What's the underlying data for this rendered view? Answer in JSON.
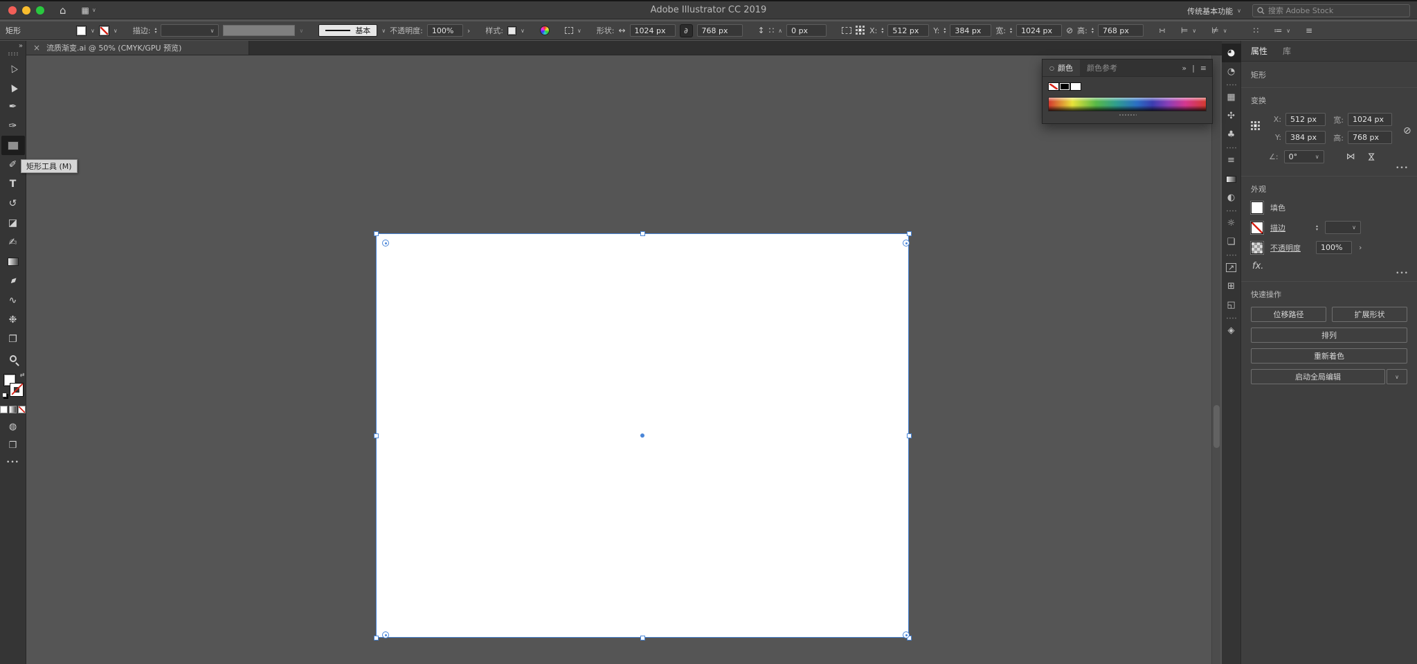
{
  "colors": {
    "accent_blue": "#4a86d8",
    "canvas_gray": "#555555",
    "none_red": "#d82418"
  },
  "icons": {
    "home": "⌂",
    "layout_grid": "▦",
    "chevron_down": "∨",
    "chevron_right": "›",
    "chevron_up": "∧",
    "stepper_up": "▴",
    "stepper_down": "▾",
    "collapse": "»",
    "menu": "≡",
    "close": "×",
    "more": "•••",
    "link": "∂",
    "unlink": "⊘",
    "width_arrow": "↔",
    "height_arrow": "↕",
    "dots": "∷",
    "flip": "⋈",
    "angle": "∠:",
    "swap": "⇄",
    "tab_dot": "○",
    "transform_more": "∺",
    "align_objects": "⊨",
    "distribute_objects": "⊭",
    "align_to": "≔",
    "export_arrow": "↗"
  },
  "window": {
    "title": "Adobe Illustrator CC 2019",
    "workspace_switcher": "传统基本功能",
    "search_placeholder": "搜索 Adobe Stock"
  },
  "control_bar": {
    "tool_name": "矩形",
    "stroke_label": "描边:",
    "stroke_style": "基本",
    "opacity_label": "不透明度:",
    "opacity_value": "100%",
    "style_label": "样式:",
    "shape_label": "形状:",
    "shape_width": "1024 px",
    "shape_height": "768 px",
    "corner_radius": "0 px",
    "x_label": "X:",
    "x_value": "512 px",
    "y_label": "Y:",
    "y_value": "384 px",
    "width_label": "宽:",
    "width_value": "1024 px",
    "height_label": "高:",
    "height_value": "768 px"
  },
  "document_tab": {
    "title": "流质渐变.ai @ 50% (CMYK/GPU 预览)"
  },
  "tooltip": {
    "text": "矩形工具 (M)"
  },
  "tools": [
    {
      "name": "selection-tool",
      "g": "△",
      "cls": "cursor"
    },
    {
      "name": "direct-selection-tool",
      "g": "▲",
      "cls": "cursor"
    },
    {
      "name": "pen-tool",
      "g": "✒"
    },
    {
      "name": "curvature-tool",
      "g": "✑"
    },
    {
      "name": "rectangle-tool",
      "g": "",
      "cls": "shape-rect",
      "selected": true
    },
    {
      "name": "paintbrush-tool",
      "g": "✐"
    },
    {
      "name": "type-tool",
      "g": "T",
      "cls": "type"
    },
    {
      "name": "rotate-tool",
      "g": "↺"
    },
    {
      "name": "eraser-tool",
      "g": "◪"
    },
    {
      "name": "shaper-tool",
      "g": "✍"
    },
    {
      "name": "gradient-tool",
      "g": "",
      "cls": "shape-grad"
    },
    {
      "name": "eyedropper-tool",
      "g": "♦",
      "cls": "eyedrop"
    },
    {
      "name": "blend-tool",
      "g": "∿"
    },
    {
      "name": "symbol-sprayer-tool",
      "g": "❉"
    },
    {
      "name": "artboard-tool",
      "g": "❐"
    },
    {
      "name": "zoom-tool",
      "g": "",
      "cls": "shape-zoom"
    }
  ],
  "dock_icons": [
    {
      "name": "color-panel-icon",
      "g": "◕",
      "selected": true
    },
    {
      "name": "gradient-panel-icon",
      "g": "◔"
    },
    {
      "cls": "divider",
      "g": ""
    },
    {
      "name": "swatches-panel-icon",
      "g": "▦"
    },
    {
      "name": "brushes-panel-icon",
      "g": "✣"
    },
    {
      "name": "symbols-panel-icon",
      "g": "♣"
    },
    {
      "cls": "divider",
      "g": ""
    },
    {
      "name": "stroke-panel-icon",
      "g": "≡"
    },
    {
      "name": "gradient-slider-panel-icon",
      "g": "",
      "cls": "shape-grad"
    },
    {
      "name": "transparency-panel-icon",
      "g": "◐"
    },
    {
      "cls": "divider",
      "g": ""
    },
    {
      "name": "effects-panel-icon",
      "g": "☼"
    },
    {
      "name": "graphic-styles-panel-icon",
      "g": "❏"
    },
    {
      "cls": "divider",
      "g": ""
    },
    {
      "name": "export-panel-icon",
      "g": "↗",
      "cls": "boxed"
    },
    {
      "name": "artboards-panel-icon",
      "g": "⊞"
    },
    {
      "name": "pathfinder-panel-icon",
      "g": "◱"
    },
    {
      "cls": "divider",
      "g": ""
    },
    {
      "name": "layers-panel-icon",
      "g": "◈"
    }
  ],
  "color_panel": {
    "tab_color": "颜色",
    "tab_color_guide": "颜色参考"
  },
  "properties_panel": {
    "tab_properties": "属性",
    "tab_libraries": "库",
    "object_type": "矩形",
    "transform": {
      "title": "变换",
      "x_label": "X:",
      "x_value": "512 px",
      "y_label": "Y:",
      "y_value": "384 px",
      "w_label": "宽:",
      "w_value": "1024 px",
      "h_label": "高:",
      "h_value": "768 px",
      "angle_value": "0°"
    },
    "appearance": {
      "title": "外观",
      "fill_label": "填色",
      "stroke_label": "描边",
      "opacity_label": "不透明度",
      "opacity_value": "100%",
      "fx_label": "fx."
    },
    "quick_actions": {
      "title": "快速操作",
      "offset_path": "位移路径",
      "expand_shape": "扩展形状",
      "arrange": "排列",
      "recolor": "重新着色",
      "global_edit": "启动全局编辑"
    }
  }
}
